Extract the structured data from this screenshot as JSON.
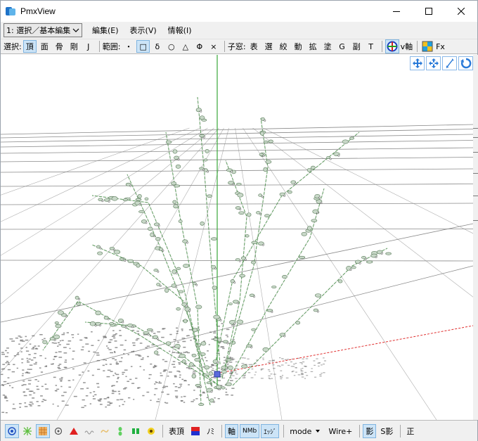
{
  "window": {
    "title": "PmxView"
  },
  "menubar": {
    "mode_select": "1: 選択／基本編集",
    "items": [
      "編集(E)",
      "表示(V)",
      "情報(I)"
    ]
  },
  "toolbar": {
    "select_label": "選択:",
    "select_buttons": [
      "頂",
      "面",
      "骨",
      "剛",
      "J"
    ],
    "range_label": "範囲:",
    "range_buttons": [
      "・",
      "□",
      "δ",
      "○",
      "△",
      "Φ",
      "×"
    ],
    "child_label": "子窓:",
    "child_buttons": [
      "表",
      "選",
      "絞",
      "動",
      "拡",
      "塗",
      "G",
      "副",
      "T"
    ],
    "v_axis_label": "v軸",
    "fx_label": "Fx"
  },
  "bottombar": {
    "buttons": {
      "surface_vertex": "表頂",
      "nomi": "ﾉﾐ",
      "axis": "軸",
      "nmb": "NMb",
      "edge": "ｴｯｼﾞ",
      "mode": "mode",
      "wire": "Wire+",
      "shadow": "影",
      "s_shadow": "S影",
      "ortho": "正"
    }
  },
  "colors": {
    "accent": "#0078d7",
    "active_bg": "#cce4f7",
    "grid_line": "#8a8a8a",
    "bone_green": "#3a9a3a",
    "x_axis_red": "#e03030"
  },
  "icons": {
    "title": "pmxview-app-icon",
    "viewport_controls": [
      "move-view-icon",
      "move-xy-icon",
      "zoom-icon",
      "rotate-view-icon"
    ],
    "toolbar": [
      "v-axis-icon",
      "fx-icon"
    ]
  }
}
